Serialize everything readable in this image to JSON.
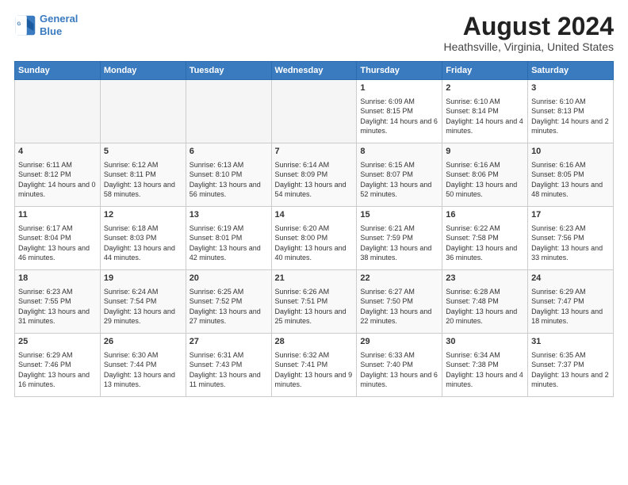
{
  "header": {
    "logo_line1": "General",
    "logo_line2": "Blue",
    "title": "August 2024",
    "location": "Heathsville, Virginia, United States"
  },
  "days_of_week": [
    "Sunday",
    "Monday",
    "Tuesday",
    "Wednesday",
    "Thursday",
    "Friday",
    "Saturday"
  ],
  "weeks": [
    [
      {
        "day": "",
        "empty": true
      },
      {
        "day": "",
        "empty": true
      },
      {
        "day": "",
        "empty": true
      },
      {
        "day": "",
        "empty": true
      },
      {
        "day": "1",
        "sunrise": "6:09 AM",
        "sunset": "8:15 PM",
        "daylight": "14 hours and 6 minutes."
      },
      {
        "day": "2",
        "sunrise": "6:10 AM",
        "sunset": "8:14 PM",
        "daylight": "14 hours and 4 minutes."
      },
      {
        "day": "3",
        "sunrise": "6:10 AM",
        "sunset": "8:13 PM",
        "daylight": "14 hours and 2 minutes."
      }
    ],
    [
      {
        "day": "4",
        "sunrise": "6:11 AM",
        "sunset": "8:12 PM",
        "daylight": "14 hours and 0 minutes."
      },
      {
        "day": "5",
        "sunrise": "6:12 AM",
        "sunset": "8:11 PM",
        "daylight": "13 hours and 58 minutes."
      },
      {
        "day": "6",
        "sunrise": "6:13 AM",
        "sunset": "8:10 PM",
        "daylight": "13 hours and 56 minutes."
      },
      {
        "day": "7",
        "sunrise": "6:14 AM",
        "sunset": "8:09 PM",
        "daylight": "13 hours and 54 minutes."
      },
      {
        "day": "8",
        "sunrise": "6:15 AM",
        "sunset": "8:07 PM",
        "daylight": "13 hours and 52 minutes."
      },
      {
        "day": "9",
        "sunrise": "6:16 AM",
        "sunset": "8:06 PM",
        "daylight": "13 hours and 50 minutes."
      },
      {
        "day": "10",
        "sunrise": "6:16 AM",
        "sunset": "8:05 PM",
        "daylight": "13 hours and 48 minutes."
      }
    ],
    [
      {
        "day": "11",
        "sunrise": "6:17 AM",
        "sunset": "8:04 PM",
        "daylight": "13 hours and 46 minutes."
      },
      {
        "day": "12",
        "sunrise": "6:18 AM",
        "sunset": "8:03 PM",
        "daylight": "13 hours and 44 minutes."
      },
      {
        "day": "13",
        "sunrise": "6:19 AM",
        "sunset": "8:01 PM",
        "daylight": "13 hours and 42 minutes."
      },
      {
        "day": "14",
        "sunrise": "6:20 AM",
        "sunset": "8:00 PM",
        "daylight": "13 hours and 40 minutes."
      },
      {
        "day": "15",
        "sunrise": "6:21 AM",
        "sunset": "7:59 PM",
        "daylight": "13 hours and 38 minutes."
      },
      {
        "day": "16",
        "sunrise": "6:22 AM",
        "sunset": "7:58 PM",
        "daylight": "13 hours and 36 minutes."
      },
      {
        "day": "17",
        "sunrise": "6:23 AM",
        "sunset": "7:56 PM",
        "daylight": "13 hours and 33 minutes."
      }
    ],
    [
      {
        "day": "18",
        "sunrise": "6:23 AM",
        "sunset": "7:55 PM",
        "daylight": "13 hours and 31 minutes."
      },
      {
        "day": "19",
        "sunrise": "6:24 AM",
        "sunset": "7:54 PM",
        "daylight": "13 hours and 29 minutes."
      },
      {
        "day": "20",
        "sunrise": "6:25 AM",
        "sunset": "7:52 PM",
        "daylight": "13 hours and 27 minutes."
      },
      {
        "day": "21",
        "sunrise": "6:26 AM",
        "sunset": "7:51 PM",
        "daylight": "13 hours and 25 minutes."
      },
      {
        "day": "22",
        "sunrise": "6:27 AM",
        "sunset": "7:50 PM",
        "daylight": "13 hours and 22 minutes."
      },
      {
        "day": "23",
        "sunrise": "6:28 AM",
        "sunset": "7:48 PM",
        "daylight": "13 hours and 20 minutes."
      },
      {
        "day": "24",
        "sunrise": "6:29 AM",
        "sunset": "7:47 PM",
        "daylight": "13 hours and 18 minutes."
      }
    ],
    [
      {
        "day": "25",
        "sunrise": "6:29 AM",
        "sunset": "7:46 PM",
        "daylight": "13 hours and 16 minutes."
      },
      {
        "day": "26",
        "sunrise": "6:30 AM",
        "sunset": "7:44 PM",
        "daylight": "13 hours and 13 minutes."
      },
      {
        "day": "27",
        "sunrise": "6:31 AM",
        "sunset": "7:43 PM",
        "daylight": "13 hours and 11 minutes."
      },
      {
        "day": "28",
        "sunrise": "6:32 AM",
        "sunset": "7:41 PM",
        "daylight": "13 hours and 9 minutes."
      },
      {
        "day": "29",
        "sunrise": "6:33 AM",
        "sunset": "7:40 PM",
        "daylight": "13 hours and 6 minutes."
      },
      {
        "day": "30",
        "sunrise": "6:34 AM",
        "sunset": "7:38 PM",
        "daylight": "13 hours and 4 minutes."
      },
      {
        "day": "31",
        "sunrise": "6:35 AM",
        "sunset": "7:37 PM",
        "daylight": "13 hours and 2 minutes."
      }
    ]
  ],
  "labels": {
    "sunrise": "Sunrise:",
    "sunset": "Sunset:",
    "daylight": "Daylight hours"
  }
}
